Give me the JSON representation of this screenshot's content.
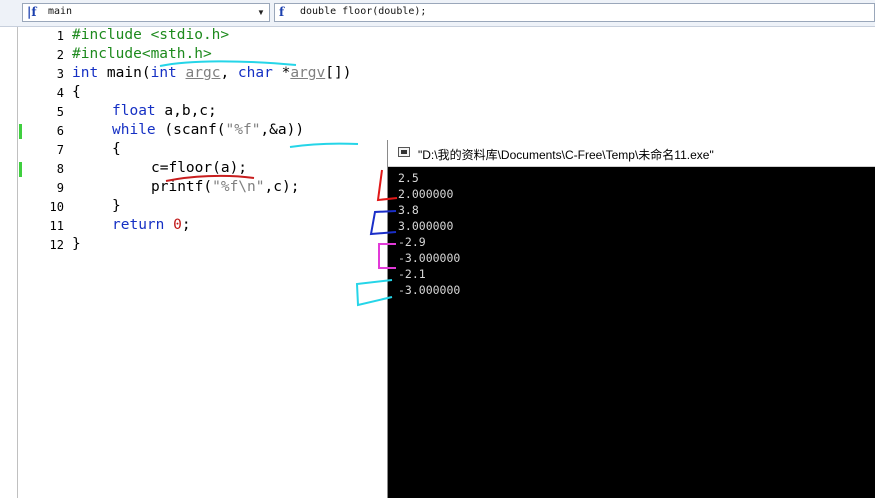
{
  "toolbar": {
    "function_combo": {
      "icon": "function-icon",
      "value": "main"
    },
    "signature_combo": {
      "icon": "function-icon",
      "value": "double floor(double);"
    }
  },
  "editor": {
    "line_numbers": [
      "1",
      "2",
      "3",
      "4",
      "5",
      "6",
      "7",
      "8",
      "9",
      "10",
      "11",
      "12"
    ],
    "lines": {
      "l1": {
        "pp": "#include <stdio.h>"
      },
      "l2": {
        "pp": "#include<math.h>"
      },
      "l3": {
        "kw1": "int",
        "t1": " main(",
        "kw2": "int",
        "t2": " ",
        "p1": "argc",
        "t3": ", ",
        "kw3": "char",
        "t4": " *",
        "p2": "argv",
        "t5": "[])"
      },
      "l4": {
        "t": "{"
      },
      "l5": {
        "kw": "float",
        "t": " a,b,c;"
      },
      "l6": {
        "kw": "while",
        "t1": " (scanf(",
        "s": "\"%f\"",
        "t2": ",&a))"
      },
      "l7": {
        "t": "{"
      },
      "l8": {
        "t1": "c=floor(a);"
      },
      "l9": {
        "t1": "printf(",
        "s": "\"%f\\n\"",
        "t2": ",c);"
      },
      "l10": {
        "t": "}"
      },
      "l11": {
        "kw": "return",
        "t1": " ",
        "n": "0",
        "t2": ";"
      },
      "l12": {
        "t": "}"
      }
    }
  },
  "console": {
    "title": "\"D:\\我的资料库\\Documents\\C-Free\\Temp\\未命名11.exe\"",
    "output": [
      "2.5",
      "2.000000",
      "3.8",
      "3.000000",
      "-2.9",
      "-3.000000",
      "-2.1",
      "-3.000000"
    ]
  }
}
